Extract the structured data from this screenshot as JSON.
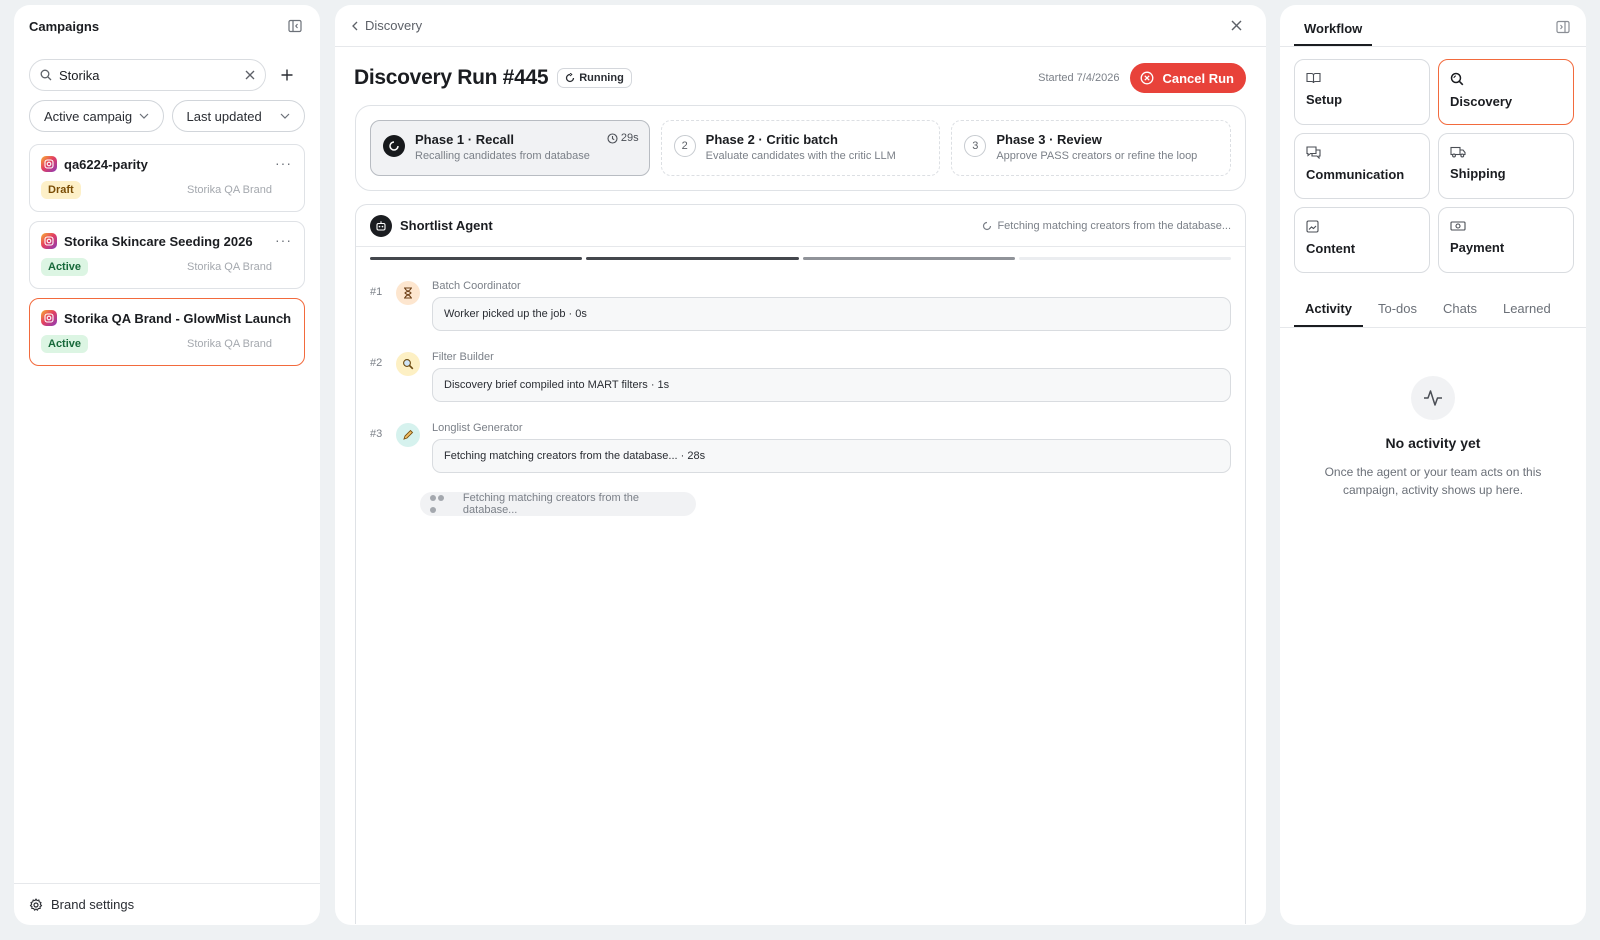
{
  "left": {
    "title": "Campaigns",
    "search": {
      "value": "Storika"
    },
    "filters": {
      "status": "Active campaig",
      "sort": "Last updated"
    },
    "campaigns": [
      {
        "name": "qa6224-parity",
        "status": "Draft",
        "brand": "Storika QA Brand"
      },
      {
        "name": "Storika Skincare Seeding 2026",
        "status": "Active",
        "brand": "Storika QA Brand"
      },
      {
        "name": "Storika QA Brand - GlowMist Launch",
        "status": "Active",
        "brand": "Storika QA Brand"
      }
    ],
    "footer": "Brand settings"
  },
  "center": {
    "breadcrumb": "Discovery",
    "title": "Discovery Run #445",
    "status": "Running",
    "started": "Started 7/4/2026",
    "cancel": "Cancel Run",
    "phases": [
      {
        "num": "",
        "title": "Phase 1 · Recall",
        "sub": "Recalling candidates from database",
        "time": "29s"
      },
      {
        "num": "2",
        "title": "Phase 2 · Critic batch",
        "sub": "Evaluate candidates with the critic LLM"
      },
      {
        "num": "3",
        "title": "Phase 3 · Review",
        "sub": "Approve PASS creators or refine the loop"
      }
    ],
    "agent": {
      "name": "Shortlist Agent",
      "status": "Fetching matching creators from the database...",
      "progress": [
        1,
        1,
        0.6,
        0
      ],
      "steps": [
        {
          "num": "#1",
          "label": "Batch Coordinator",
          "text": "Worker picked up the job · 0s"
        },
        {
          "num": "#2",
          "label": "Filter Builder",
          "text": "Discovery brief compiled into MART filters · 1s"
        },
        {
          "num": "#3",
          "label": "Longlist Generator",
          "text": "Fetching matching creators from the database... · 28s"
        }
      ],
      "typing": "Fetching matching creators from the database..."
    }
  },
  "right": {
    "tab": "Workflow",
    "cards": [
      {
        "label": "Setup",
        "icon": "book-icon"
      },
      {
        "label": "Discovery",
        "icon": "search-icon"
      },
      {
        "label": "Communication",
        "icon": "chat-icon"
      },
      {
        "label": "Shipping",
        "icon": "truck-icon"
      },
      {
        "label": "Content",
        "icon": "image-icon"
      },
      {
        "label": "Payment",
        "icon": "money-icon"
      }
    ],
    "tabs": [
      "Activity",
      "To-dos",
      "Chats",
      "Learned"
    ],
    "empty": {
      "title": "No activity yet",
      "sub": "Once the agent or your team acts on this campaign, activity shows up here."
    }
  },
  "colors": {
    "accent": "#f26a3d",
    "danger": "#e8423a"
  }
}
